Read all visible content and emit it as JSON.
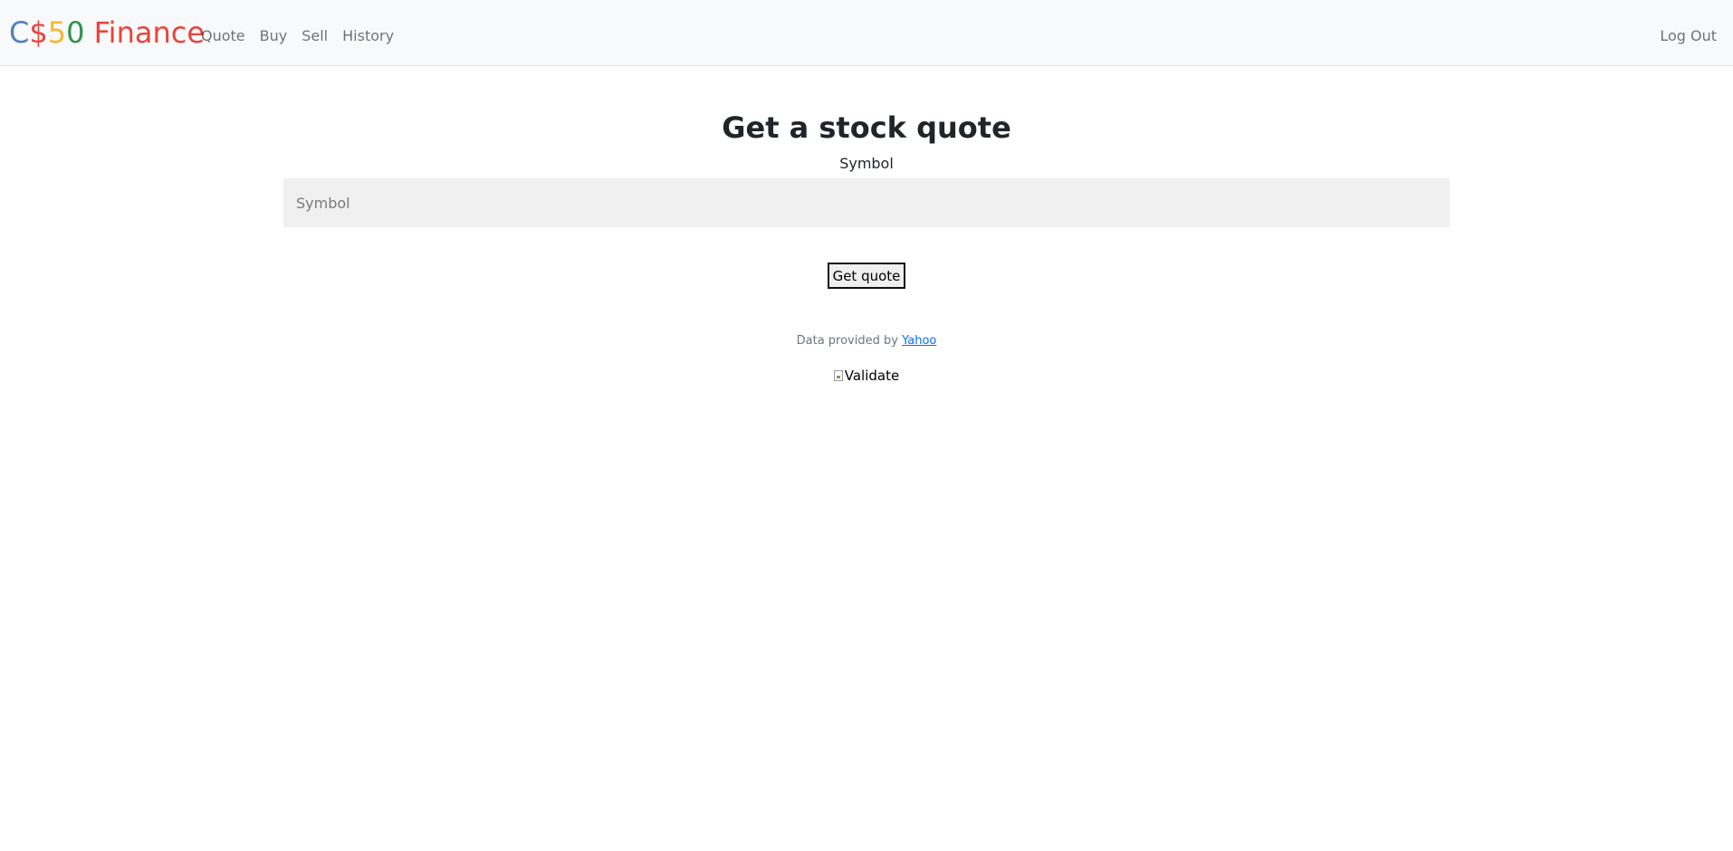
{
  "navbar": {
    "brand": {
      "part1": "C",
      "part2": "$",
      "part3": "5",
      "part4": "0",
      "part5": " Finance",
      "colors": [
        "#537fbe",
        "#ea433b",
        "#f5b82e",
        "#2e944b",
        "#ea433b"
      ]
    },
    "links": {
      "quote": "Quote",
      "buy": "Buy",
      "sell": "Sell",
      "history": "History"
    },
    "logout": "Log Out"
  },
  "main": {
    "title": "Get a stock quote",
    "symbol_label": "Symbol",
    "symbol_value": "",
    "symbol_placeholder": "Symbol",
    "submit_label": "Get quote"
  },
  "footer": {
    "text": "Data provided by",
    "link_label": "Yahoo",
    "image_alt": "Validate"
  }
}
